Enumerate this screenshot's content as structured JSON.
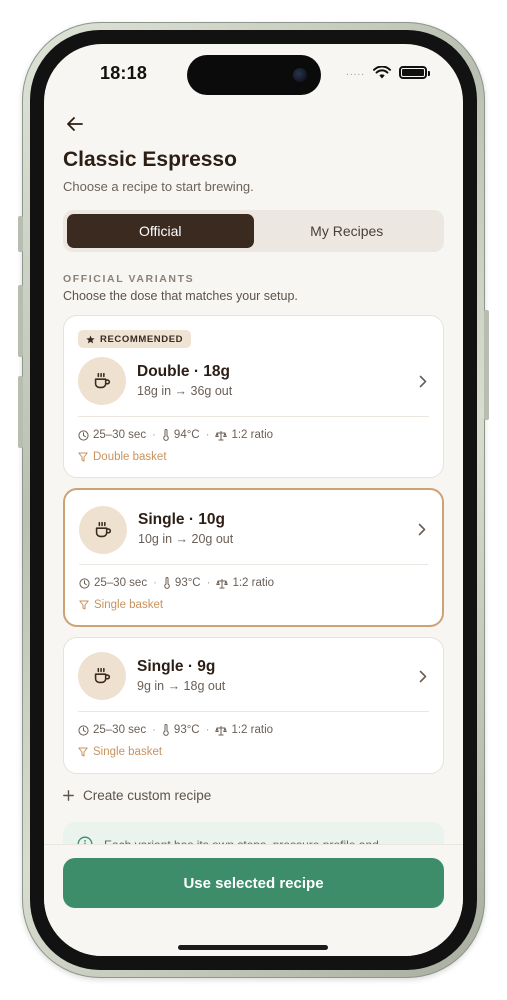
{
  "status_bar": {
    "time": "18:18",
    "signal": "....."
  },
  "header": {
    "title": "Classic Espresso",
    "subtitle": "Choose a recipe to start brewing."
  },
  "tabs": [
    {
      "label": "Official",
      "active": true
    },
    {
      "label": "My Recipes",
      "active": false
    }
  ],
  "section": {
    "label": "OFFICIAL VARIANTS",
    "description": "Choose the dose that matches your setup."
  },
  "variants": [
    {
      "badge": "RECOMMENDED",
      "name": "Double · 18g",
      "dose": "18g in → 36g out",
      "time": "25–30 sec",
      "temp": "94°C",
      "ratio": "1:2 ratio",
      "basket": "Double basket",
      "selected": false
    },
    {
      "name": "Single · 10g",
      "dose": "10g in → 20g out",
      "time": "25–30 sec",
      "temp": "93°C",
      "ratio": "1:2 ratio",
      "basket": "Single basket",
      "selected": true
    },
    {
      "name": "Single · 9g",
      "dose": "9g in → 18g out",
      "time": "25–30 sec",
      "temp": "93°C",
      "ratio": "1:2 ratio",
      "basket": "Single basket",
      "selected": false
    }
  ],
  "meta_separator": "·",
  "create_custom": "Create custom recipe",
  "info_note": "Each variant has its own steps, pressure profile and",
  "cta_label": "Use selected recipe",
  "colors": {
    "accent": "#3d8d6b",
    "primary_dark": "#3a2a20",
    "selected_border": "#cfa274",
    "basket_text": "#c9925d",
    "background": "#f8f6f2"
  },
  "icons": {
    "back": "arrow-left-icon",
    "card": "coffee-cup-icon",
    "chevron": "chevron-right-icon",
    "time": "clock-icon",
    "temp": "thermometer-icon",
    "ratio": "scale-icon",
    "basket": "filter-icon",
    "badge": "star-icon",
    "create": "plus-icon",
    "info": "info-icon"
  }
}
